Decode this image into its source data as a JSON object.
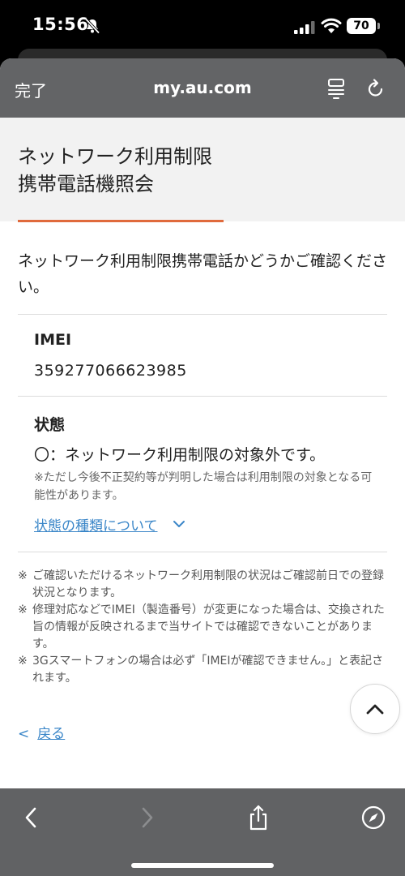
{
  "status_bar": {
    "time": "15:56",
    "battery": "70"
  },
  "browser": {
    "done_label": "完了",
    "url": "my.au.com"
  },
  "page": {
    "title_line1": "ネットワーク利用制限",
    "title_line2": "携帯電話機照会",
    "intro": "ネットワーク利用制限携帯電話かどうかご確認ください。",
    "imei_label": "IMEI",
    "imei_value": "359277066623985",
    "status_label": "状態",
    "status_text": "〇：ネットワーク利用制限の対象外です。",
    "status_note": "※ただし今後不正契約等が判明した場合は利用制限の対象となる可能性があります。",
    "status_link": "状態の種類について",
    "notes": [
      "ご確認いただけるネットワーク利用制限の状況はご確認前日での登録状況となります。",
      "修理対応などでIMEI（製造番号）が変更になった場合は、交換された旨の情報が反映されるまで当サイトでは確認できないことがあります。",
      "3Gスマートフォンの場合は必ず「IMEIが確認できません。」と表記されます。"
    ],
    "back_label": "戻る"
  },
  "colors": {
    "accent_underline": "#e06a3c",
    "link": "#3a86c8",
    "browser_chrome": "#636466"
  },
  "icons": [
    "bell-slash-icon",
    "signal-icon",
    "wifi-icon",
    "battery-icon",
    "reader-icon",
    "reload-icon",
    "chevron-down-icon",
    "chevron-up-icon",
    "chevron-left-icon",
    "chevron-right-icon",
    "share-icon",
    "compass-icon"
  ]
}
